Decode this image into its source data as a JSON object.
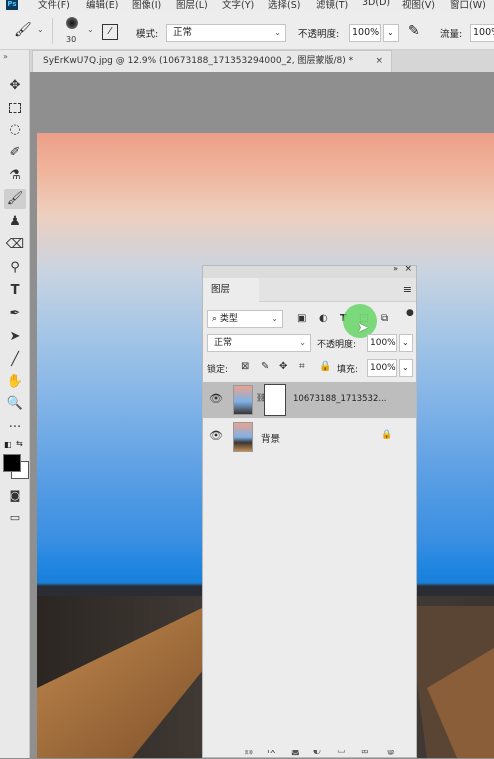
{
  "menubar": {
    "logo": "Ps",
    "items": [
      "文件(F)",
      "编辑(E)",
      "图像(I)",
      "图层(L)",
      "文字(Y)",
      "选择(S)",
      "滤镜(T)",
      "3D(D)",
      "视图(V)",
      "窗口(W)"
    ]
  },
  "options": {
    "brush_size": "30",
    "mode_label": "模式:",
    "mode_value": "正常",
    "opacity_label": "不透明度:",
    "opacity_value": "100%",
    "flow_label": "流量:",
    "flow_value": "100%"
  },
  "tab": {
    "title": "SyErKwU7Q.jpg @ 12.9% (10673188_171353294000_2, 图层蒙版/8) *",
    "close": "×"
  },
  "layers_panel": {
    "collapse": "»",
    "close": "×",
    "tab_label": "图层",
    "menu_icon": "≡",
    "filter_value": "类型",
    "blend_mode": "正常",
    "opacity_label": "不透明度:",
    "opacity_value": "100%",
    "lock_label": "锁定:",
    "fill_label": "填充:",
    "fill_value": "100%",
    "layers": [
      {
        "name": "10673188_1713532...",
        "selected": true,
        "has_mask": true
      },
      {
        "name": "背景",
        "selected": false,
        "locked": true
      }
    ]
  },
  "colors": {
    "foreground": "#000000",
    "background": "#ffffff",
    "highlight": "#5fd35f"
  }
}
